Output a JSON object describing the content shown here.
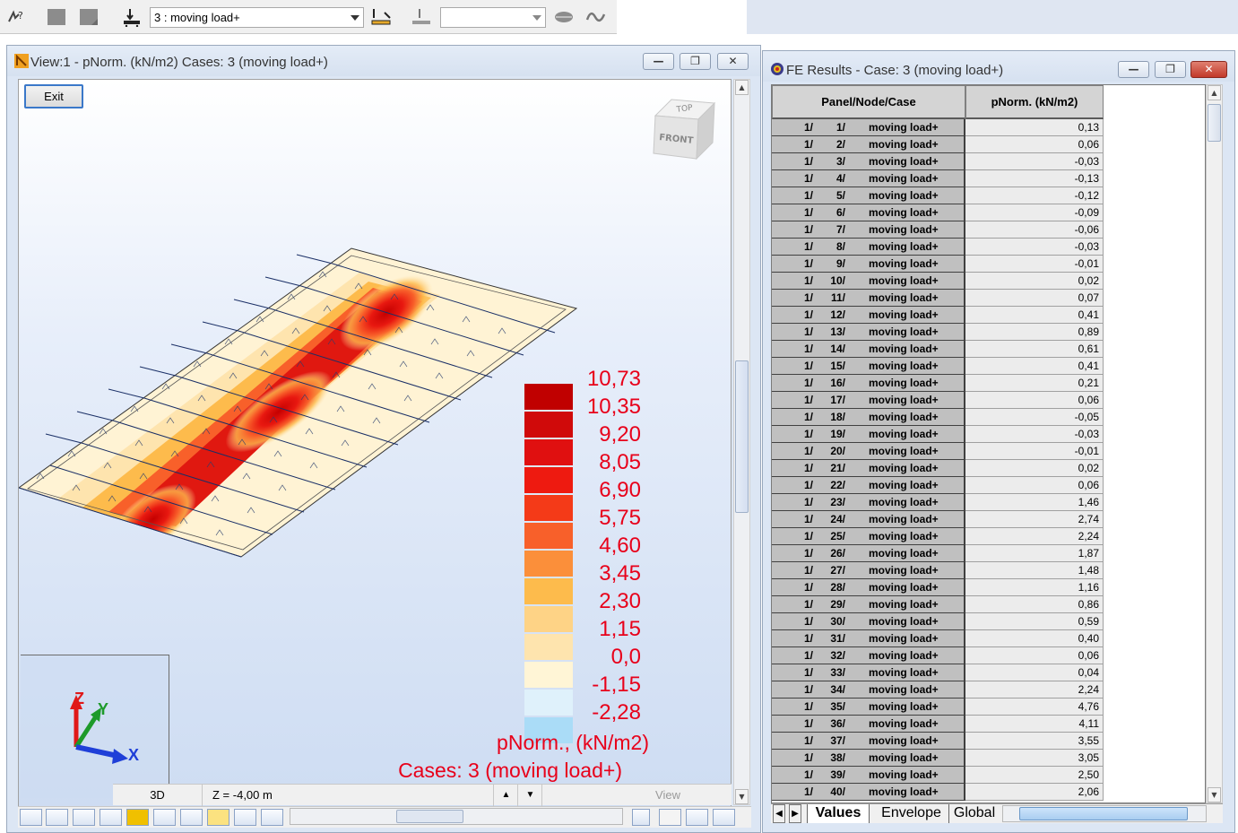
{
  "toolbar": {
    "load_case_select": "3 : moving load+",
    "secondary_select": "",
    "icons": [
      "help-cursor-icon",
      "gray-square-icon",
      "gray-square-icon",
      "load-case-icon",
      "moving-load-icon",
      "load-icon",
      "dropdown",
      "lips-icon",
      "wave-icon"
    ]
  },
  "view_window": {
    "title": "View:1 - pNorm. (kN/m2) Cases: 3 (moving load+)",
    "exit_label": "Exit",
    "cube_top": "TOP",
    "cube_front": "FRONT",
    "axes": {
      "z": "Z",
      "y": "Y",
      "x": "X"
    },
    "legend": {
      "labels": [
        "10,73",
        "10,35",
        "9,20",
        "8,05",
        "6,90",
        "5,75",
        "4,60",
        "3,45",
        "2,30",
        "1,15",
        "0,0",
        "-1,15",
        "-2,28"
      ],
      "colors": [
        "#c00000",
        "#d00a0a",
        "#e01010",
        "#ee1a10",
        "#f43a18",
        "#f8602a",
        "#fb8f3a",
        "#fdbb4c",
        "#fed386",
        "#fee4ae",
        "#fff5d6",
        "#dff1fb",
        "#aadcf7"
      ],
      "quantity": "pNorm., (kN/m2)",
      "cases": "Cases: 3 (moving load+)"
    },
    "status": {
      "mode": "3D",
      "z_level": "Z = -4,00 m",
      "view": "View"
    }
  },
  "fe_window": {
    "title": "FE Results - Case: 3 (moving load+)",
    "columns": [
      "Panel/Node/Case",
      "pNorm. (kN/m2)"
    ],
    "rows": [
      {
        "panel": "1/",
        "node": "1/",
        "case": "moving load+",
        "value": "0,13"
      },
      {
        "panel": "1/",
        "node": "2/",
        "case": "moving load+",
        "value": "0,06"
      },
      {
        "panel": "1/",
        "node": "3/",
        "case": "moving load+",
        "value": "-0,03"
      },
      {
        "panel": "1/",
        "node": "4/",
        "case": "moving load+",
        "value": "-0,13"
      },
      {
        "panel": "1/",
        "node": "5/",
        "case": "moving load+",
        "value": "-0,12"
      },
      {
        "panel": "1/",
        "node": "6/",
        "case": "moving load+",
        "value": "-0,09"
      },
      {
        "panel": "1/",
        "node": "7/",
        "case": "moving load+",
        "value": "-0,06"
      },
      {
        "panel": "1/",
        "node": "8/",
        "case": "moving load+",
        "value": "-0,03"
      },
      {
        "panel": "1/",
        "node": "9/",
        "case": "moving load+",
        "value": "-0,01"
      },
      {
        "panel": "1/",
        "node": "10/",
        "case": "moving load+",
        "value": "0,02"
      },
      {
        "panel": "1/",
        "node": "11/",
        "case": "moving load+",
        "value": "0,07"
      },
      {
        "panel": "1/",
        "node": "12/",
        "case": "moving load+",
        "value": "0,41"
      },
      {
        "panel": "1/",
        "node": "13/",
        "case": "moving load+",
        "value": "0,89"
      },
      {
        "panel": "1/",
        "node": "14/",
        "case": "moving load+",
        "value": "0,61"
      },
      {
        "panel": "1/",
        "node": "15/",
        "case": "moving load+",
        "value": "0,41"
      },
      {
        "panel": "1/",
        "node": "16/",
        "case": "moving load+",
        "value": "0,21"
      },
      {
        "panel": "1/",
        "node": "17/",
        "case": "moving load+",
        "value": "0,06"
      },
      {
        "panel": "1/",
        "node": "18/",
        "case": "moving load+",
        "value": "-0,05"
      },
      {
        "panel": "1/",
        "node": "19/",
        "case": "moving load+",
        "value": "-0,03"
      },
      {
        "panel": "1/",
        "node": "20/",
        "case": "moving load+",
        "value": "-0,01"
      },
      {
        "panel": "1/",
        "node": "21/",
        "case": "moving load+",
        "value": "0,02"
      },
      {
        "panel": "1/",
        "node": "22/",
        "case": "moving load+",
        "value": "0,06"
      },
      {
        "panel": "1/",
        "node": "23/",
        "case": "moving load+",
        "value": "1,46"
      },
      {
        "panel": "1/",
        "node": "24/",
        "case": "moving load+",
        "value": "2,74"
      },
      {
        "panel": "1/",
        "node": "25/",
        "case": "moving load+",
        "value": "2,24"
      },
      {
        "panel": "1/",
        "node": "26/",
        "case": "moving load+",
        "value": "1,87"
      },
      {
        "panel": "1/",
        "node": "27/",
        "case": "moving load+",
        "value": "1,48"
      },
      {
        "panel": "1/",
        "node": "28/",
        "case": "moving load+",
        "value": "1,16"
      },
      {
        "panel": "1/",
        "node": "29/",
        "case": "moving load+",
        "value": "0,86"
      },
      {
        "panel": "1/",
        "node": "30/",
        "case": "moving load+",
        "value": "0,59"
      },
      {
        "panel": "1/",
        "node": "31/",
        "case": "moving load+",
        "value": "0,40"
      },
      {
        "panel": "1/",
        "node": "32/",
        "case": "moving load+",
        "value": "0,06"
      },
      {
        "panel": "1/",
        "node": "33/",
        "case": "moving load+",
        "value": "0,04"
      },
      {
        "panel": "1/",
        "node": "34/",
        "case": "moving load+",
        "value": "2,24"
      },
      {
        "panel": "1/",
        "node": "35/",
        "case": "moving load+",
        "value": "4,76"
      },
      {
        "panel": "1/",
        "node": "36/",
        "case": "moving load+",
        "value": "4,11"
      },
      {
        "panel": "1/",
        "node": "37/",
        "case": "moving load+",
        "value": "3,55"
      },
      {
        "panel": "1/",
        "node": "38/",
        "case": "moving load+",
        "value": "3,05"
      },
      {
        "panel": "1/",
        "node": "39/",
        "case": "moving load+",
        "value": "2,50"
      },
      {
        "panel": "1/",
        "node": "40/",
        "case": "moving load+",
        "value": "2,06"
      }
    ],
    "tabs": [
      "Values",
      "Envelope",
      "Global"
    ],
    "active_tab": "Values"
  },
  "colors": {
    "window_chrome": "#dce6f4",
    "legend_text": "#e8001a",
    "axis_x": "#1f3fd8",
    "axis_y": "#1d9a2a",
    "axis_z": "#e01818"
  }
}
